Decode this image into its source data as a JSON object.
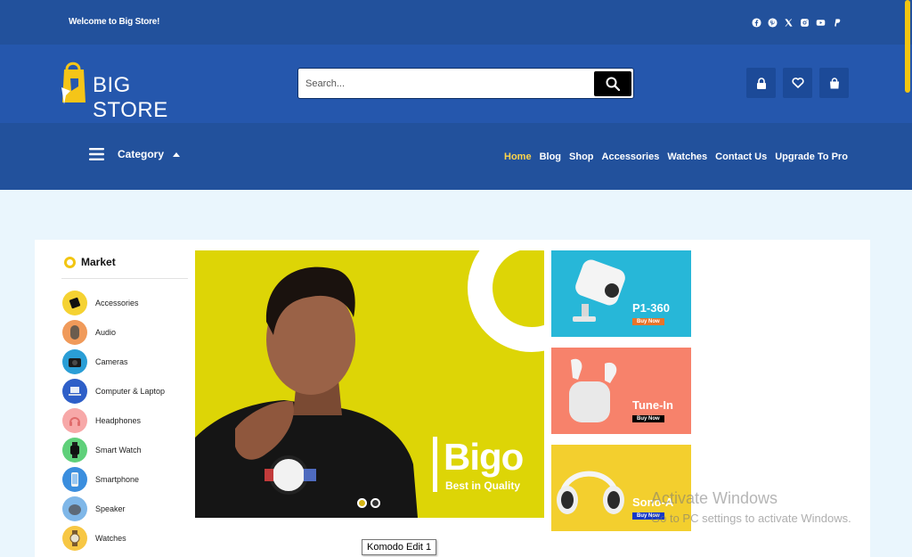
{
  "topbar": {
    "welcome": "Welcome to Big Store!",
    "social_icons": [
      "facebook-icon",
      "pinterest-icon",
      "x-icon",
      "instagram-icon",
      "youtube-icon",
      "paypal-icon"
    ]
  },
  "header": {
    "brand": "BIG STORE",
    "search_placeholder": "Search...",
    "icons": [
      "lock-icon",
      "heart-icon",
      "bag-icon"
    ]
  },
  "nav": {
    "category_label": "Category",
    "items": [
      "Home",
      "Blog",
      "Shop",
      "Accessories",
      "Watches",
      "Contact Us",
      "Upgrade To Pro"
    ],
    "active_item": "Home"
  },
  "market": {
    "title": "Market",
    "categories": [
      "Accessories",
      "Audio",
      "Cameras",
      "Computer & Laptop",
      "Headphones",
      "Smart Watch",
      "Smartphone",
      "Speaker",
      "Watches"
    ]
  },
  "hero": {
    "title": "Bigo",
    "subtitle": "Best in Quality",
    "slides": 2,
    "active_slide": 1
  },
  "promos": [
    {
      "title": "P1-360",
      "button": "Buy Now",
      "bg": "#27b7d8",
      "button_bg": "#e8742a"
    },
    {
      "title": "Tune-In",
      "button": "Buy Now",
      "bg": "#f7826b",
      "button_bg": "#000000"
    },
    {
      "title": "Sono-A",
      "button": "Buy Now",
      "bg": "#f3cf2e",
      "button_bg": "#1538c7"
    }
  ],
  "watermark": {
    "line1": "Activate Windows",
    "line2": "Go to PC settings to activate Windows."
  },
  "tooltip": "Komodo Edit 1",
  "colors": {
    "topbar": "#22519c",
    "header": "#2557ad",
    "accent": "#f2c511",
    "page_bg": "#eaf6fd"
  }
}
